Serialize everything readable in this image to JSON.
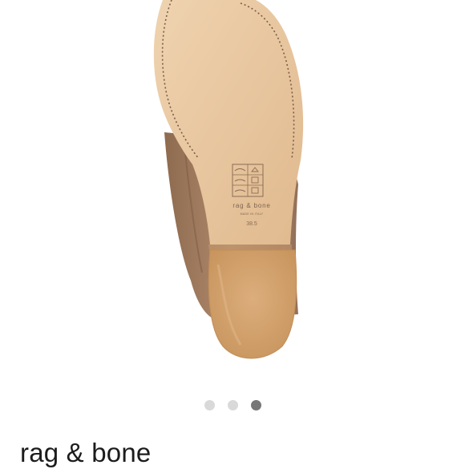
{
  "gallery": {
    "image_alt": "rag & bone boot sole",
    "sole_brand_text": "rag & bone",
    "sole_origin_text": "MADE IN ITALY",
    "sole_size_text": "38.5",
    "dots": [
      {
        "label": "image-1",
        "active": false
      },
      {
        "label": "image-2",
        "active": false
      },
      {
        "label": "image-3",
        "active": true
      }
    ]
  },
  "product": {
    "brand": "rag & bone"
  },
  "colors": {
    "sole": "#e7c49d",
    "heel": "#d4a36f",
    "suede": "#a67c5e",
    "dot_inactive": "#d9d9d9",
    "dot_active": "#777777"
  }
}
